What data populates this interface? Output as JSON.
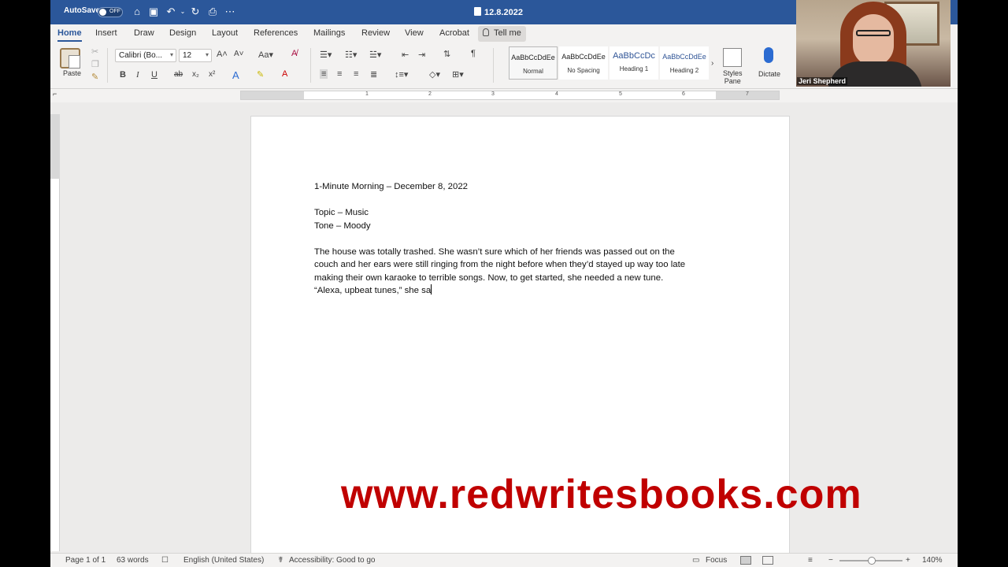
{
  "titlebar": {
    "autosave_label": "AutoSave",
    "autosave_state": "OFF",
    "doc_title": "12.8.2022"
  },
  "tabs": [
    "Home",
    "Insert",
    "Draw",
    "Design",
    "Layout",
    "References",
    "Mailings",
    "Review",
    "View",
    "Acrobat"
  ],
  "tellme": "Tell me",
  "ribbon": {
    "paste_label": "Paste",
    "font_name": "Calibri (Bo...",
    "font_size": "12",
    "styles": [
      {
        "preview": "AaBbCcDdEe",
        "name": "Normal"
      },
      {
        "preview": "AaBbCcDdEe",
        "name": "No Spacing"
      },
      {
        "preview": "AaBbCcDc",
        "name": "Heading 1"
      },
      {
        "preview": "AaBbCcDdEe",
        "name": "Heading 2"
      }
    ],
    "styles_pane": [
      "Styles",
      "Pane"
    ],
    "dictate": "Dictate"
  },
  "ruler_numbers": [
    "1",
    "2",
    "3",
    "4",
    "5",
    "6",
    "7"
  ],
  "document": {
    "title": "1-Minute Morning – December 8, 2022",
    "topic": "Topic – Music",
    "tone": "Tone – Moody",
    "body_lines": [
      "The house was totally trashed. She wasn’t sure which of her friends was passed out on the",
      "couch and her ears were still ringing from the night before when they’d stayed up way too late",
      "making their own karaoke to terrible songs. Now, to get started, she needed a new tune.",
      "“Alexa, upbeat tunes,” she sa"
    ]
  },
  "status": {
    "page": "Page 1 of 1",
    "words": "63 words",
    "language": "English (United States)",
    "accessibility": "Accessibility: Good to go",
    "focus": "Focus",
    "zoom": "140%"
  },
  "webcam": {
    "name": "Jeri Shepherd"
  },
  "watermark": "www.redwritesbooks.com"
}
